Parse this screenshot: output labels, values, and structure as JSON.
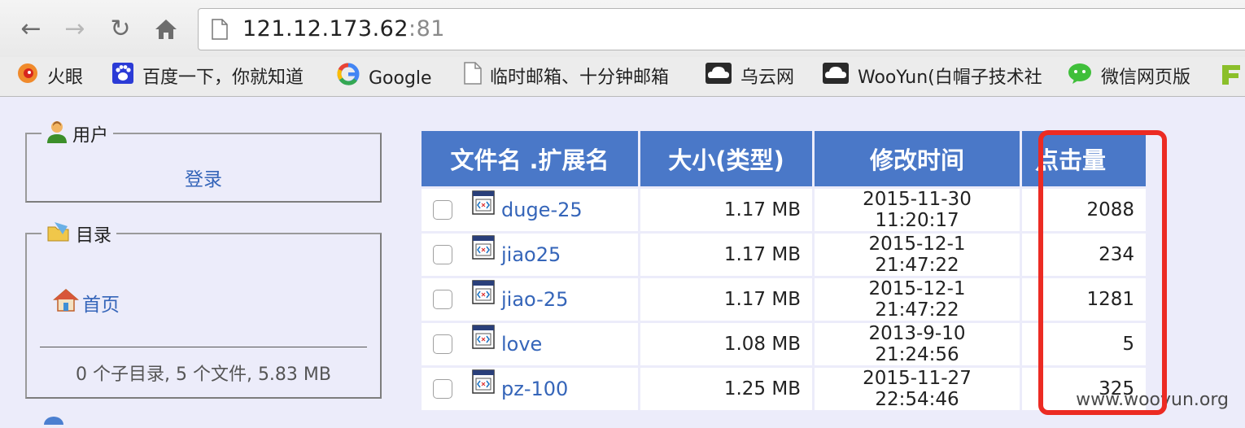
{
  "browser": {
    "url_host": "121.12.173.62",
    "url_port": ":81",
    "bookmarks": [
      {
        "label": "火眼",
        "icon": "fire-eye-icon"
      },
      {
        "label": "百度一下，你就知道",
        "icon": "baidu-paw-icon"
      },
      {
        "label": "Google",
        "icon": "google-icon"
      },
      {
        "label": "临时邮箱、十分钟邮箱",
        "icon": "page-icon"
      },
      {
        "label": "乌云网",
        "icon": "cloud-icon"
      },
      {
        "label": "WooYun(白帽子技术社",
        "icon": "cloud-icon"
      },
      {
        "label": "微信网页版",
        "icon": "wechat-icon"
      }
    ]
  },
  "sidebar": {
    "user_box": {
      "title": "用户",
      "login": "登录"
    },
    "dir_box": {
      "title": "目录",
      "home": "首页",
      "summary": "0 个子目录, 5 个文件, 5.83 MB"
    }
  },
  "table": {
    "headers": [
      "文件名 .扩展名",
      "大小(类型)",
      "修改时间",
      "点击量"
    ],
    "rows": [
      {
        "name": "duge-25",
        "size": "1.17 MB",
        "mtime": "2015-11-30 11:20:17",
        "hits": "2088"
      },
      {
        "name": "jiao25",
        "size": "1.17 MB",
        "mtime": "2015-12-1 21:47:22",
        "hits": "234"
      },
      {
        "name": "jiao-25",
        "size": "1.17 MB",
        "mtime": "2015-12-1 21:47:22",
        "hits": "1281"
      },
      {
        "name": "love",
        "size": "1.08 MB",
        "mtime": "2013-9-10 21:24:56",
        "hits": "5"
      },
      {
        "name": "pz-100",
        "size": "1.25 MB",
        "mtime": "2015-11-27 22:54:46",
        "hits": "325"
      }
    ]
  },
  "watermark": "www.wooyun.org",
  "colors": {
    "header_bg": "#4a78c8",
    "link": "#3565b9",
    "highlight": "#ec2b23",
    "page_bg": "#ececfa"
  }
}
